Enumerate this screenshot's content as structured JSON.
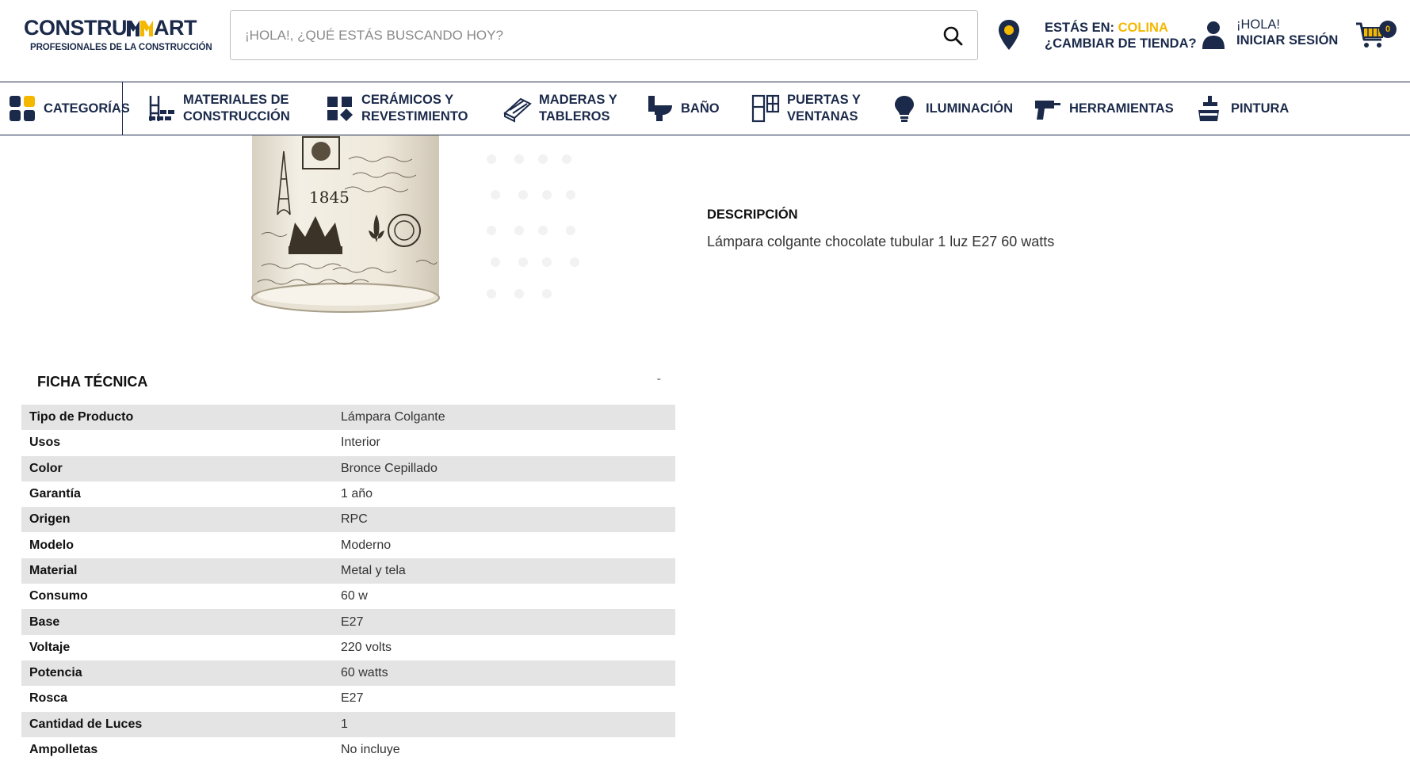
{
  "brand": {
    "name_part1": "CONSTRU",
    "name_part2": "ART",
    "tagline": "PROFESIONALES DE LA CONSTRUCCIÓN"
  },
  "search": {
    "placeholder": "¡HOLA!, ¿QUÉ ESTÁS BUSCANDO HOY?",
    "icon": "search-icon"
  },
  "store": {
    "prefix": "ESTÁS EN: ",
    "name": "COLINA",
    "change_label": "¿CAMBIAR DE TIENDA?"
  },
  "account": {
    "greeting": "¡HOLA!",
    "signin_label": "INICIAR SESIÓN"
  },
  "cart": {
    "count": "0"
  },
  "colors": {
    "navy": "#1b2a4a",
    "yellow": "#f5b800"
  },
  "nav": {
    "items": [
      {
        "line1": "CATEGORÍAS",
        "line2": "",
        "icon": "categories-icon"
      },
      {
        "line1": "MATERIALES DE",
        "line2": "CONSTRUCCIÓN",
        "icon": "bricks-icon"
      },
      {
        "line1": "CERÁMICOS Y",
        "line2": "REVESTIMIENTO",
        "icon": "tiles-icon"
      },
      {
        "line1": "MADERAS Y",
        "line2": "TABLEROS",
        "icon": "wood-icon"
      },
      {
        "line1": "BAÑO",
        "line2": "",
        "icon": "toilet-icon"
      },
      {
        "line1": "PUERTAS Y",
        "line2": "VENTANAS",
        "icon": "door-icon"
      },
      {
        "line1": "ILUMINACIÓN",
        "line2": "",
        "icon": "bulb-icon"
      },
      {
        "line1": "HERRAMIENTAS",
        "line2": "",
        "icon": "drill-icon"
      },
      {
        "line1": "PINTURA",
        "line2": "",
        "icon": "paint-icon"
      }
    ]
  },
  "product_image": {
    "year_text": "1845"
  },
  "description": {
    "title": "DESCRIPCIÓN",
    "text": "Lámpara colgante chocolate tubular 1 luz E27 60 watts"
  },
  "specs": {
    "title": "FICHA TÉCNICA",
    "toggle": "-",
    "rows": [
      {
        "key": "Tipo de Producto",
        "value": "Lámpara Colgante"
      },
      {
        "key": "Usos",
        "value": "Interior"
      },
      {
        "key": "Color",
        "value": "Bronce Cepillado"
      },
      {
        "key": "Garantía",
        "value": "1 año"
      },
      {
        "key": "Origen",
        "value": "RPC"
      },
      {
        "key": "Modelo",
        "value": "Moderno"
      },
      {
        "key": "Material",
        "value": "Metal y tela"
      },
      {
        "key": "Consumo",
        "value": "60 w"
      },
      {
        "key": "Base",
        "value": "E27"
      },
      {
        "key": "Voltaje",
        "value": "220 volts"
      },
      {
        "key": "Potencia",
        "value": "60 watts"
      },
      {
        "key": "Rosca",
        "value": "E27"
      },
      {
        "key": "Cantidad de Luces",
        "value": "1"
      },
      {
        "key": "Ampolletas",
        "value": "No incluye"
      }
    ]
  }
}
